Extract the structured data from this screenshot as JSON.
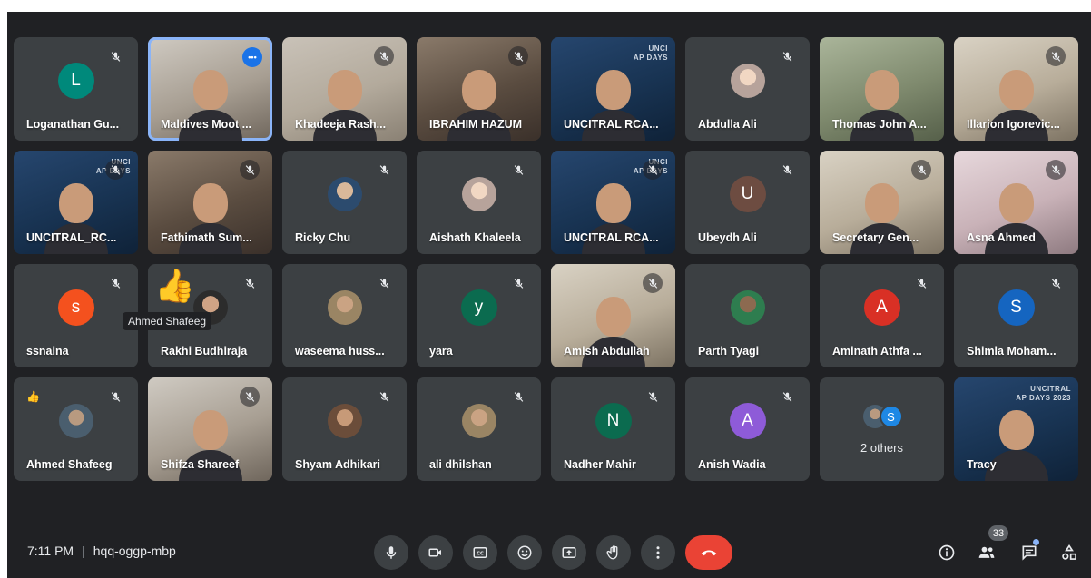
{
  "participants": [
    {
      "name": "Loganathan Gu...",
      "kind": "letter",
      "initial": "L",
      "color": "#00897b",
      "muted": true
    },
    {
      "name": "Maldives Moot ...",
      "kind": "video",
      "muted": false,
      "more": true,
      "active": true
    },
    {
      "name": "Khadeeja Rash...",
      "kind": "video",
      "muted": true
    },
    {
      "name": "IBRAHIM HAZUM",
      "kind": "video",
      "muted": true
    },
    {
      "name": "UNCITRAL RCA...",
      "kind": "video",
      "muted": false,
      "overlay": "UNCI\nAP DAYS"
    },
    {
      "name": "Abdulla Ali",
      "kind": "photo",
      "muted": true
    },
    {
      "name": "Thomas John A...",
      "kind": "video",
      "muted": false
    },
    {
      "name": "Illarion Igorevic...",
      "kind": "video",
      "muted": true
    },
    {
      "name": "UNCITRAL_RC...",
      "kind": "video",
      "muted": true,
      "overlay": "UNCI\nAP DAYS"
    },
    {
      "name": "Fathimath Sum...",
      "kind": "video",
      "muted": true
    },
    {
      "name": "Ricky Chu",
      "kind": "photo",
      "muted": true
    },
    {
      "name": "Aishath Khaleela",
      "kind": "photo",
      "muted": true
    },
    {
      "name": "UNCITRAL RCA...",
      "kind": "video",
      "muted": true,
      "overlay": "UNCI\nAP DAYS"
    },
    {
      "name": "Ubeydh Ali",
      "kind": "letter",
      "initial": "U",
      "color": "#6d4c41",
      "muted": true
    },
    {
      "name": "Secretary Gen...",
      "kind": "video",
      "muted": true
    },
    {
      "name": "Asna Ahmed",
      "kind": "video",
      "muted": true
    },
    {
      "name": "ssnaina",
      "kind": "letter",
      "initial": "s",
      "color": "#f4511e",
      "muted": true
    },
    {
      "name": "Rakhi Budhiraja",
      "kind": "photo",
      "muted": true
    },
    {
      "name": "waseema huss...",
      "kind": "photo",
      "muted": true
    },
    {
      "name": "yara",
      "kind": "letter",
      "initial": "y",
      "color": "#0b6b4f",
      "muted": true
    },
    {
      "name": "Amish Abdullah",
      "kind": "video",
      "muted": true
    },
    {
      "name": "Parth Tyagi",
      "kind": "photo",
      "muted": false
    },
    {
      "name": "Aminath Athfa ...",
      "kind": "letter",
      "initial": "A",
      "color": "#d93025",
      "muted": true
    },
    {
      "name": "Shimla Moham...",
      "kind": "letter",
      "initial": "S",
      "color": "#1565c0",
      "muted": true
    },
    {
      "name": "Ahmed Shafeeg",
      "kind": "photo",
      "muted": true,
      "reaction": "👍"
    },
    {
      "name": "Shifza Shareef",
      "kind": "video",
      "muted": true
    },
    {
      "name": "Shyam Adhikari",
      "kind": "photo",
      "muted": true
    },
    {
      "name": "ali dhilshan",
      "kind": "photo",
      "muted": true
    },
    {
      "name": "Nadher Mahir",
      "kind": "letter",
      "initial": "N",
      "color": "#0b6b4f",
      "muted": true
    },
    {
      "name": "Anish Wadia",
      "kind": "letter",
      "initial": "A",
      "color": "#8e5bd8",
      "muted": true
    },
    {
      "name": "",
      "kind": "others",
      "others_label": "2 others",
      "others_initial": "S"
    },
    {
      "name": "Tracy",
      "kind": "video",
      "muted": false,
      "overlay": "UNCITRAL\nAP DAYS 2023"
    }
  ],
  "tooltip": "Ahmed Shafeeg",
  "reaction_big": "👍",
  "meeting": {
    "time": "7:11 PM",
    "separator": "|",
    "code": "hqq-oggp-mbp"
  },
  "controls": {
    "mic_icon": "mic-icon",
    "camera_icon": "camera-icon",
    "captions_icon": "captions-icon",
    "emoji_icon": "emoji-icon",
    "present_icon": "present-icon",
    "hand_icon": "raise-hand-icon",
    "more_icon": "more-options-icon",
    "end_icon": "end-call-icon"
  },
  "right_controls": {
    "people_count": "33"
  },
  "colors": {
    "background": "#202124",
    "tile": "#3c4043",
    "end_call": "#ea4335",
    "accent": "#8ab4f8"
  }
}
